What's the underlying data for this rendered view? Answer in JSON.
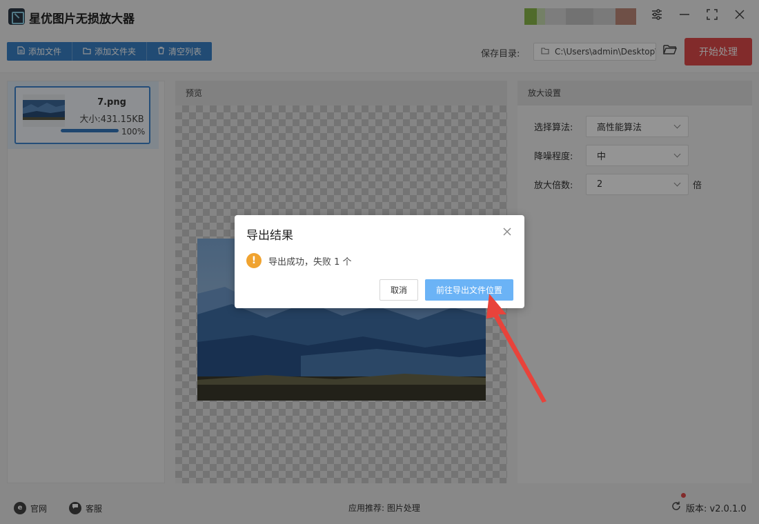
{
  "app": {
    "title": "星优图片无损放大器"
  },
  "toolbar": {
    "add_file": "添加文件",
    "add_folder": "添加文件夹",
    "clear_list": "清空列表",
    "save_dir_label": "保存目录:",
    "save_dir_value": "C:\\Users\\admin\\Desktop\\",
    "start_button": "开始处理"
  },
  "file_list": [
    {
      "name": "7.png",
      "size": "大小:431.15KB",
      "progress_percent": 100,
      "progress_text": "100%"
    }
  ],
  "preview": {
    "header": "预览"
  },
  "settings": {
    "header": "放大设置",
    "algorithm": {
      "label": "选择算法:",
      "value": "高性能算法"
    },
    "denoise": {
      "label": "降噪程度:",
      "value": "中"
    },
    "scale": {
      "label": "放大倍数:",
      "value": "2",
      "unit": "倍"
    }
  },
  "dialog": {
    "title": "导出结果",
    "message": "导出成功，失败 1 个",
    "cancel": "取消",
    "go_to_folder": "前往导出文件位置"
  },
  "statusbar": {
    "website": "官网",
    "support": "客服",
    "recommend": "应用推荐:  图片处理",
    "version": "版本: v2.0.1.0"
  },
  "colors": {
    "primary": "#3a82c8",
    "start": "#e04a4a",
    "accent_button": "#6bb3f6",
    "warning": "#f0a330"
  }
}
